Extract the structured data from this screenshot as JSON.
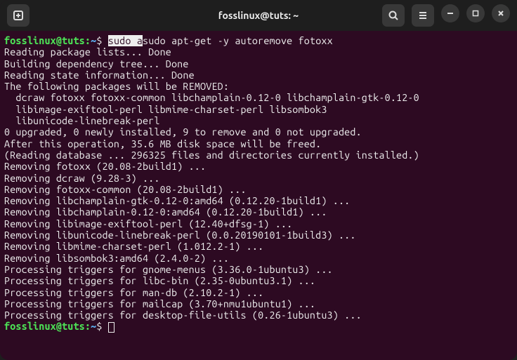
{
  "titlebar": {
    "title": "fosslinux@tuts: ~"
  },
  "prompt": {
    "userhost": "fosslinux@tuts",
    "sep": ":",
    "path": "~",
    "dollar": "$"
  },
  "cmd": {
    "highlighted": "sudo a",
    "rest": "sudo apt-get -y autoremove fotoxx"
  },
  "output": [
    "Reading package lists... Done",
    "Building dependency tree... Done",
    "Reading state information... Done",
    "The following packages will be REMOVED:",
    "  dcraw fotoxx fotoxx-common libchamplain-0.12-0 libchamplain-gtk-0.12-0",
    "  libimage-exiftool-perl libmime-charset-perl libsombok3",
    "  libunicode-linebreak-perl",
    "0 upgraded, 0 newly installed, 9 to remove and 0 not upgraded.",
    "After this operation, 35.6 MB disk space will be freed.",
    "(Reading database ... 296325 files and directories currently installed.)",
    "Removing fotoxx (20.08-2build1) ...",
    "Removing dcraw (9.28-3) ...",
    "Removing fotoxx-common (20.08-2build1) ...",
    "Removing libchamplain-gtk-0.12-0:amd64 (0.12.20-1build1) ...",
    "Removing libchamplain-0.12-0:amd64 (0.12.20-1build1) ...",
    "Removing libimage-exiftool-perl (12.40+dfsg-1) ...",
    "Removing libunicode-linebreak-perl (0.0.20190101-1build3) ...",
    "Removing libmime-charset-perl (1.012.2-1) ...",
    "Removing libsombok3:amd64 (2.4.0-2) ...",
    "Processing triggers for gnome-menus (3.36.0-1ubuntu3) ...",
    "Processing triggers for libc-bin (2.35-0ubuntu3.1) ...",
    "Processing triggers for man-db (2.10.2-1) ...",
    "Processing triggers for mailcap (3.70+nmu1ubuntu1) ...",
    "Processing triggers for desktop-file-utils (0.26-1ubuntu3) ..."
  ]
}
